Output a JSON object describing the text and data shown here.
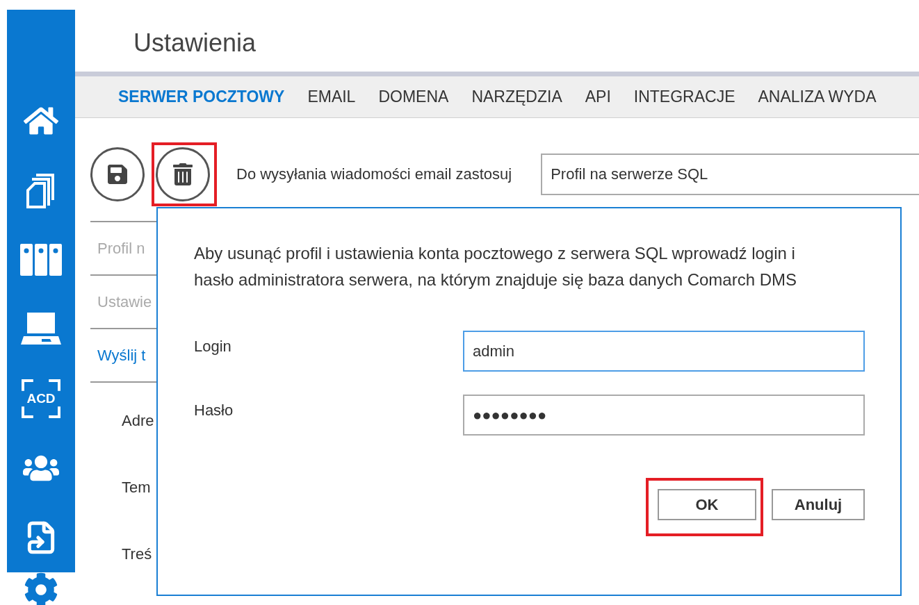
{
  "sidebar": {
    "items": [
      {
        "selected": false
      },
      {
        "selected": false
      },
      {
        "selected": false
      },
      {
        "selected": false
      },
      {
        "label": "ACD",
        "selected": false
      },
      {
        "selected": false
      },
      {
        "selected": false
      },
      {
        "selected": true
      }
    ]
  },
  "page_title": "Ustawienia",
  "tabs": [
    {
      "label": "SERWER POCZTOWY",
      "selected": true
    },
    {
      "label": "EMAIL",
      "selected": false
    },
    {
      "label": "DOMENA",
      "selected": false
    },
    {
      "label": "NARZĘDZIA",
      "selected": false
    },
    {
      "label": "API",
      "selected": false
    },
    {
      "label": "INTEGRACJE",
      "selected": false
    },
    {
      "label": "ANALIZA WYDA",
      "selected": false
    }
  ],
  "toolbar": {
    "buttons": [
      {
        "highlighted": false
      },
      {
        "highlighted": true
      }
    ],
    "label": "Do wysyłania wiadomości email zastosuj",
    "select_value": "Profil na serwerze SQL"
  },
  "form": {
    "sections": [
      {
        "label": "Profil n",
        "kind": "inactive"
      },
      {
        "label": "Ustawie",
        "kind": "inactive"
      },
      {
        "label": "Wyślij t",
        "kind": "link"
      }
    ],
    "fields": [
      "Adre",
      "Tem",
      "Treś"
    ]
  },
  "dialog": {
    "message": "Aby usunąć profil i ustawienia konta pocztowego z serwera SQL wprowadź login i hasło administratora serwera, na którym znajduje się baza danych Comarch DMS",
    "fields": [
      {
        "label": "Login",
        "value": "admin",
        "focused": true
      },
      {
        "label": "Hasło",
        "value": "●●●●●●●●",
        "focused": false
      }
    ],
    "buttons": [
      {
        "label": "OK",
        "highlighted": true
      },
      {
        "label": "Anuluj",
        "highlighted": false
      }
    ]
  }
}
